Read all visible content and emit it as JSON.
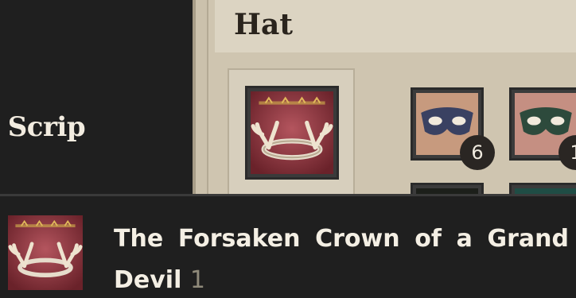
{
  "left_panel": {
    "scrip_label": "l Scrip"
  },
  "header": {
    "title": "Hat"
  },
  "selected_item": {
    "icon": "crown-antler-icon"
  },
  "grid": {
    "items": [
      {
        "icon": "navy-domino-mask-icon",
        "quantity": "6"
      },
      {
        "icon": "green-domino-mask-icon",
        "quantity": "1"
      },
      {
        "icon": "dark-item-icon"
      },
      {
        "icon": "teal-item-icon"
      }
    ]
  },
  "footer": {
    "icon": "crown-antler-icon",
    "item_name": "The Forsaken Crown of a Grand Devil",
    "item_count": "1"
  },
  "colors": {
    "dark_bg": "#1f1f1f",
    "parchment": "#cbc1ac",
    "crown_red": "#7a2d34",
    "badge": "#2a2623"
  }
}
